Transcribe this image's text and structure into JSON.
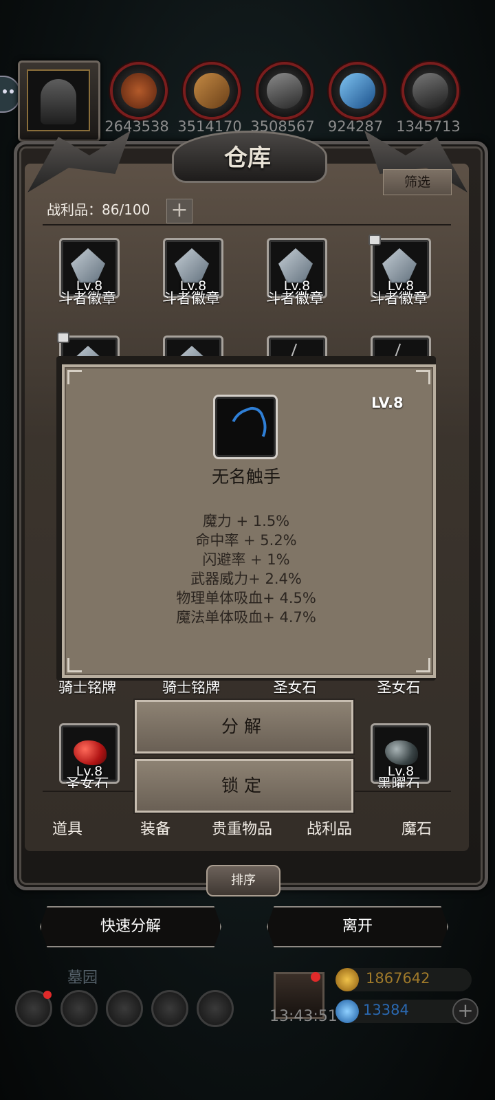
{
  "top_bar": {
    "resources": [
      {
        "icon": "leather-icon",
        "value": "2643538",
        "color": "#9a4a22"
      },
      {
        "icon": "wood-icon",
        "value": "3514170",
        "color": "#a0672f"
      },
      {
        "icon": "iron-ingot-icon",
        "value": "3508567",
        "color": "#6a6a6a"
      },
      {
        "icon": "crystal-icon",
        "value": "924287",
        "color": "#3a86c8"
      },
      {
        "icon": "steel-ingot-icon",
        "value": "1345713",
        "color": "#5a5a5a"
      }
    ]
  },
  "panel": {
    "title": "仓库",
    "filter_label": "筛选",
    "loot_count_label": "战利品：86/100",
    "add_label": "+"
  },
  "grid": {
    "row1": [
      {
        "name": "斗者徽章",
        "level": "Lv.8",
        "locked": false
      },
      {
        "name": "斗者徽章",
        "level": "Lv.8",
        "locked": false
      },
      {
        "name": "斗者徽章",
        "level": "Lv.8",
        "locked": false
      },
      {
        "name": "斗者徽章",
        "level": "Lv.8",
        "locked": true
      }
    ],
    "row_hidden_names": [
      "骑士铭牌",
      "骑士铭牌",
      "圣女石",
      "圣女石"
    ],
    "row_last": [
      {
        "name": "圣女石",
        "level": "Lv.8"
      },
      {
        "name": "黑曜石",
        "level": "Lv.8"
      }
    ]
  },
  "tooltip": {
    "level": "LV.8",
    "item_name": "无名触手",
    "stats": [
      "魔力 + 1.5%",
      "命中率 + 5.2%",
      "闪避率 + 1%",
      "武器威力+ 2.4%",
      "物理单体吸血+ 4.5%",
      "魔法单体吸血+ 4.7%"
    ]
  },
  "actions": {
    "decompose": "分解",
    "lock": "锁定"
  },
  "tabs": [
    "道具",
    "装备",
    "贵重物品",
    "战利品",
    "魔石"
  ],
  "sort_label": "排序",
  "bottom": {
    "quick_decompose": "快速分解",
    "leave": "离开"
  },
  "hud": {
    "area": "墓园",
    "timer": "13:43:51",
    "gold": "1867642",
    "gems": "13384",
    "gold_color": "#a07a2a",
    "gem_color": "#2a68b0"
  }
}
